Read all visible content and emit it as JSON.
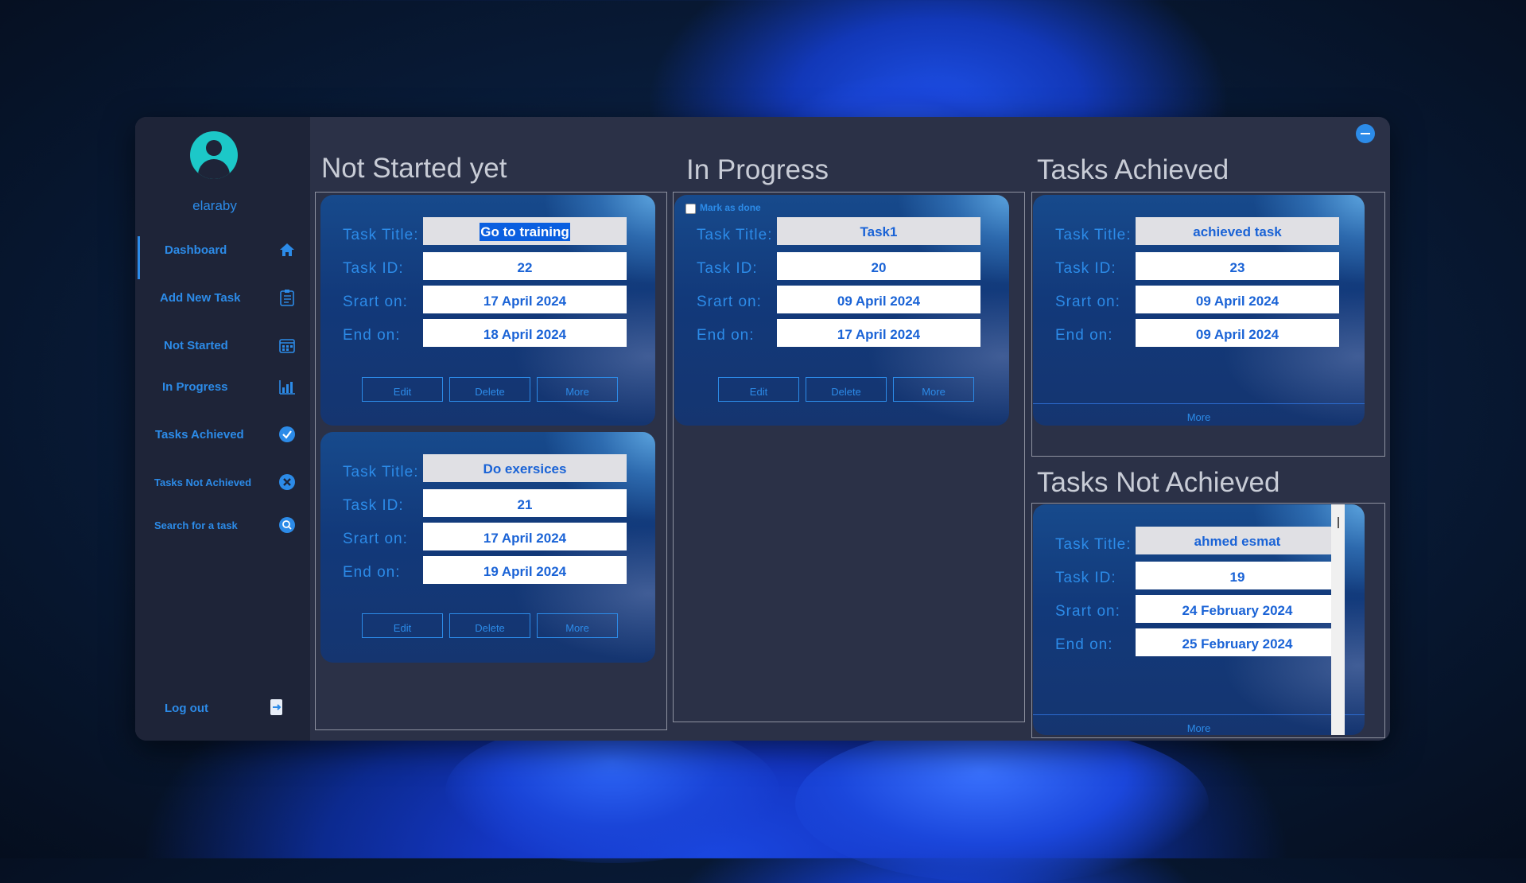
{
  "user": {
    "name": "elaraby"
  },
  "sidebar": {
    "items": [
      {
        "label": "Dashboard",
        "icon": "home-icon"
      },
      {
        "label": "Add New Task",
        "icon": "clipboard-icon"
      },
      {
        "label": "Not Started",
        "icon": "calendar-icon"
      },
      {
        "label": "In Progress",
        "icon": "bar-chart-icon"
      },
      {
        "label": "Tasks Achieved",
        "icon": "check-circle-icon"
      },
      {
        "label": "Tasks Not Achieved",
        "icon": "x-circle-icon"
      },
      {
        "label": "Search for a task",
        "icon": "search-icon"
      }
    ],
    "logout": {
      "label": "Log out",
      "icon": "logout-icon"
    }
  },
  "labels": {
    "task_title": "Task Title:",
    "task_id": "Task ID:",
    "start_on": "Srart on:",
    "end_on": "End on:",
    "edit": "Edit",
    "delete": "Delete",
    "more": "More",
    "mark_done": "Mark as done"
  },
  "columns": {
    "not_started": {
      "title": "Not Started yet",
      "cards": [
        {
          "title": "Go to training",
          "id": "22",
          "start": "17 April 2024",
          "end": "18 April 2024"
        },
        {
          "title": "Do exersices",
          "id": "21",
          "start": "17 April 2024",
          "end": "19 April 2024"
        }
      ]
    },
    "in_progress": {
      "title": "In Progress",
      "cards": [
        {
          "title": "Task1",
          "id": "20",
          "start": "09 April 2024",
          "end": "17 April 2024"
        }
      ]
    },
    "achieved": {
      "title": "Tasks Achieved",
      "cards": [
        {
          "title": "achieved task",
          "id": "23",
          "start": "09 April 2024",
          "end": "09 April 2024"
        }
      ]
    },
    "not_achieved": {
      "title": "Tasks Not Achieved",
      "cards": [
        {
          "title": "ahmed esmat",
          "id": "19",
          "start": "24 February 2024",
          "end": "25 February 2024"
        }
      ]
    }
  },
  "colors": {
    "accent": "#2c8be8",
    "sidebar": "#1e2438",
    "panel": "#2b3147",
    "avatar": "#1cc8c8"
  }
}
